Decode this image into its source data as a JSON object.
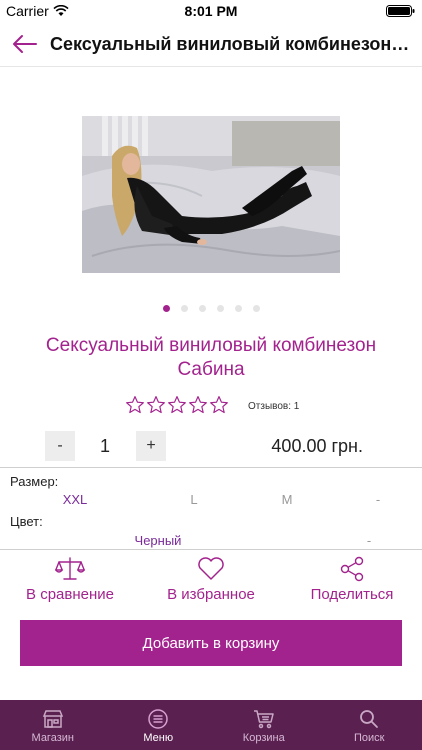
{
  "status": {
    "carrier": "Carrier",
    "time": "8:01 PM"
  },
  "header": {
    "title": "Сексуальный виниловый комбинезон С..."
  },
  "gallery": {
    "count": 6,
    "active_index": 0
  },
  "product": {
    "name": "Сексуальный виниловый комбинезон Сабина",
    "rating": 0,
    "rating_max": 5,
    "reviews_label": "Отзывов: 1",
    "quantity": "1",
    "minus": "-",
    "plus": "+",
    "price": "400.00 грн."
  },
  "options": {
    "size_label": "Размер:",
    "sizes": [
      "XXL",
      "L",
      "M",
      "-"
    ],
    "color_label": "Цвет:",
    "colors": [
      "Черный",
      "-"
    ]
  },
  "actions": {
    "compare": "В сравнение",
    "favorite": "В избранное",
    "share": "Поделиться"
  },
  "add_to_cart": "Добавить в корзину",
  "tabs": [
    {
      "label": "Магазин",
      "icon": "store-icon"
    },
    {
      "label": "Меню",
      "icon": "menu-icon"
    },
    {
      "label": "Корзина",
      "icon": "cart-icon"
    },
    {
      "label": "Поиск",
      "icon": "search-icon"
    }
  ],
  "colors": {
    "accent": "#a3238e",
    "tabbar": "#5a2050"
  }
}
